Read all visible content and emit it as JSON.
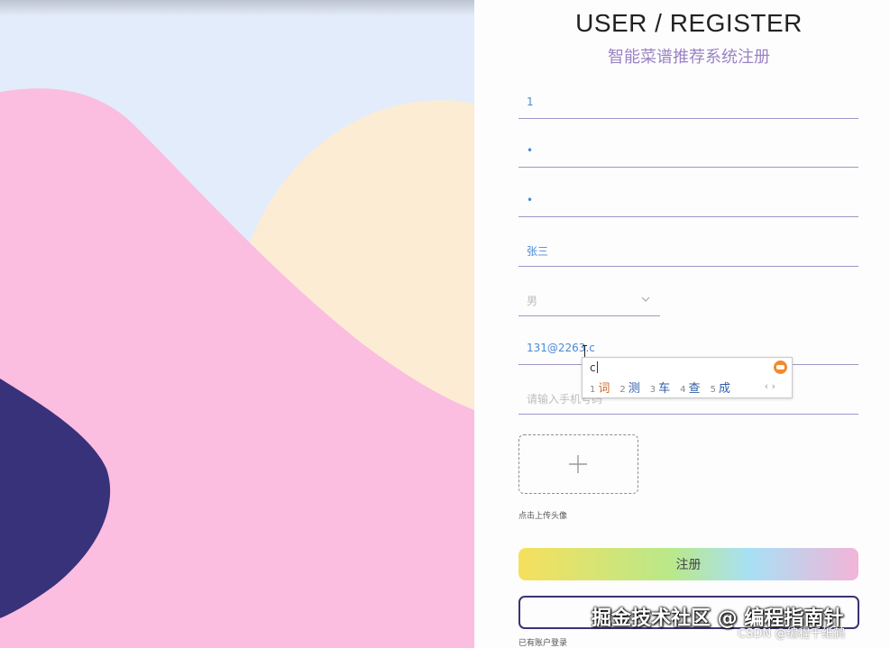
{
  "header": {
    "title": "USER / REGISTER",
    "subtitle": "智能菜谱推荐系统注册"
  },
  "form": {
    "username_value": "1",
    "password_value": "•",
    "confirm_password_value": "•",
    "name_value": "张三",
    "gender_selected": "男",
    "email_value": "131@2263.c",
    "phone_placeholder": "请输入手机号码",
    "upload_label": "点击上传头像",
    "register_label": "注册",
    "login_link": "已有账户登录"
  },
  "ime": {
    "composition": "c",
    "candidates": [
      {
        "num": "1",
        "word": "词"
      },
      {
        "num": "2",
        "word": "测"
      },
      {
        "num": "3",
        "word": "车"
      },
      {
        "num": "4",
        "word": "查"
      },
      {
        "num": "5",
        "word": "成"
      }
    ],
    "nav": "‹ ›"
  },
  "watermark": {
    "main": "掘金技术社区 @ 编程指南针",
    "sub": "CSDN @编程千纸鹤"
  },
  "colors": {
    "sky": "#e3ecfb",
    "pink_hill": "#fbbde0",
    "cream_hill": "#fcecd4",
    "navy_blob": "#37327a",
    "input_line": "#9f95c9",
    "subtitle": "#9a83c4"
  }
}
